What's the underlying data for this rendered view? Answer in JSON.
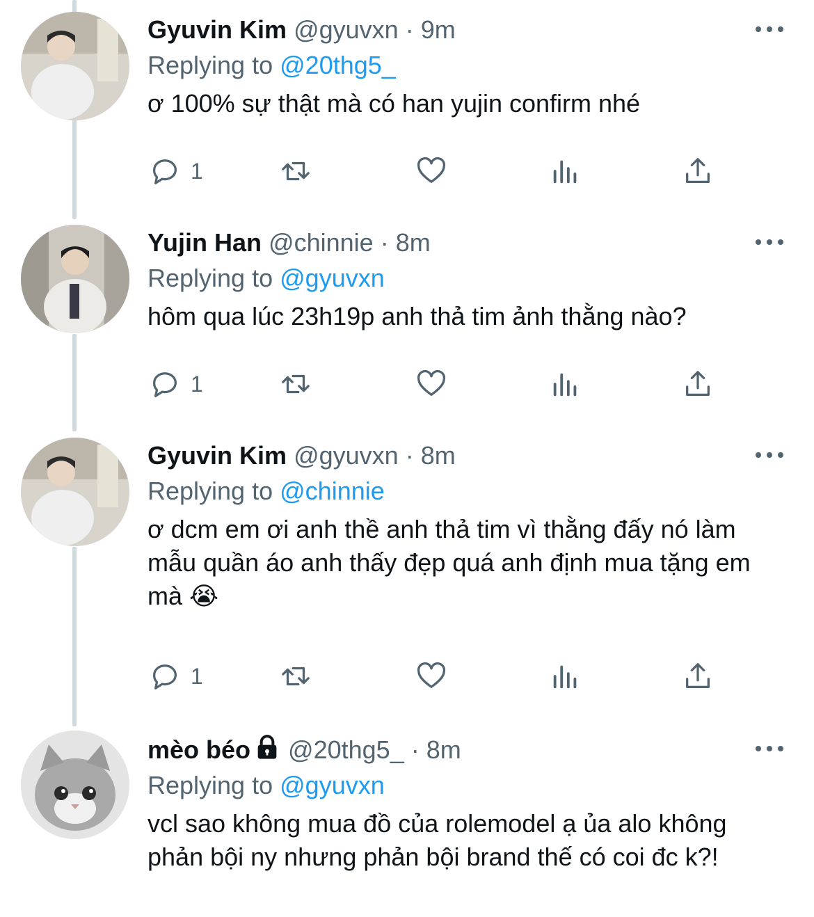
{
  "tweets": [
    {
      "name": "Gyuvin Kim",
      "handle": "@gyuvxn",
      "separator": "·",
      "time": "9m",
      "replying_prefix": "Replying to",
      "replying_to": "@20thg5_",
      "text": "ơ 100% sự thật mà có han yujin confirm nhé",
      "reply_count": "1",
      "avatar_icon": "user-photo-avatar"
    },
    {
      "name": "Yujin Han",
      "handle": "@chinnie",
      "separator": "·",
      "time": "8m",
      "replying_prefix": "Replying to",
      "replying_to": "@gyuvxn",
      "text": "hôm qua lúc 23h19p anh thả tim ảnh thằng nào?",
      "reply_count": "1",
      "avatar_icon": "user-photo-avatar"
    },
    {
      "name": "Gyuvin Kim",
      "handle": "@gyuvxn",
      "separator": "·",
      "time": "8m",
      "replying_prefix": "Replying to",
      "replying_to": "@chinnie",
      "text": "ơ dcm em ơi anh thề anh thả tim vì thằng đấy nó làm mẫu quần áo anh thấy đẹp quá anh định mua tặng em mà 😭",
      "reply_count": "1",
      "avatar_icon": "user-photo-avatar"
    },
    {
      "name": "mèo béo",
      "handle": "@20thg5_",
      "separator": "·",
      "time": "8m",
      "replying_prefix": "Replying to",
      "replying_to": "@gyuvxn",
      "text": "vcl sao không mua đồ của rolemodel ạ ủa alo không phản bội ny nhưng phản bội brand thế có coi đc k?!",
      "locked": true,
      "avatar_icon": "cat-photo-avatar"
    }
  ],
  "icons": {
    "reply": "reply-icon",
    "retweet": "retweet-icon",
    "like": "heart-icon",
    "analytics": "analytics-icon",
    "share": "share-icon",
    "more": "more-icon",
    "lock": "lock-icon"
  },
  "colors": {
    "link": "#1d9bf0",
    "secondary": "#536471",
    "thread_line": "#cfd9de"
  }
}
